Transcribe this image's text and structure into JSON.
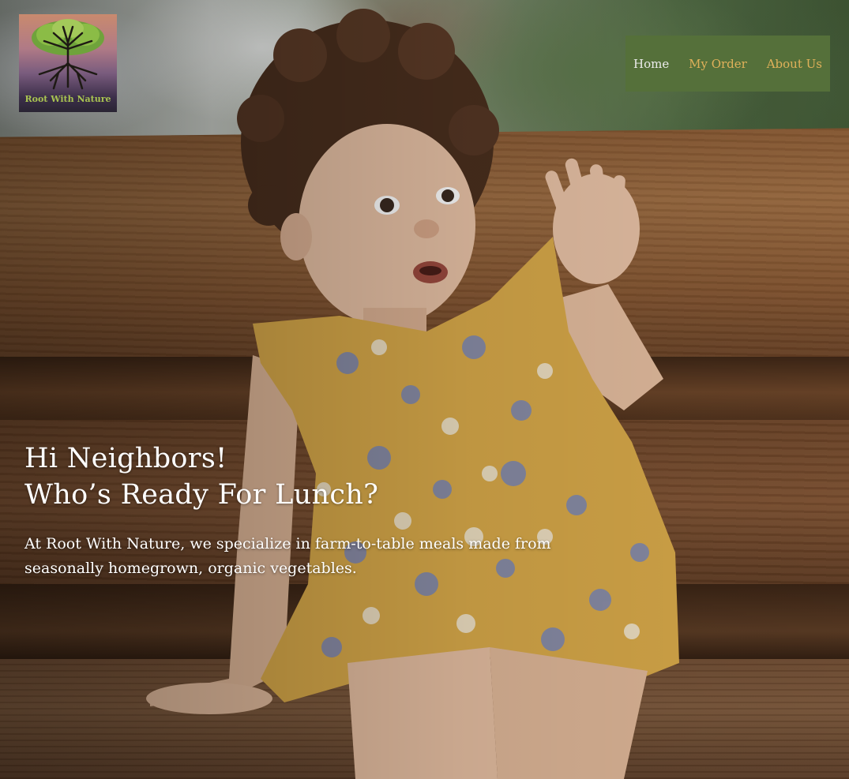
{
  "brand": {
    "name": "Root With Nature",
    "logo_icon": "tree-roots-icon",
    "text_color": "#a9c451"
  },
  "nav": {
    "background": "#55703a",
    "active_color": "#ececec",
    "link_color": "#e0b15a",
    "items": [
      {
        "label": "Home",
        "active": true
      },
      {
        "label": "My Order",
        "active": false
      },
      {
        "label": "About Us",
        "active": false
      }
    ]
  },
  "hero": {
    "headline_line1": "Hi Neighbors!",
    "headline_line2": "Who’s Ready For Lunch?",
    "tagline": "At Root With Nature, we specialize in farm-to-table meals made from seasonally homegrown, organic vegetables.",
    "background_image": "child-on-wooden-bench-photo"
  }
}
